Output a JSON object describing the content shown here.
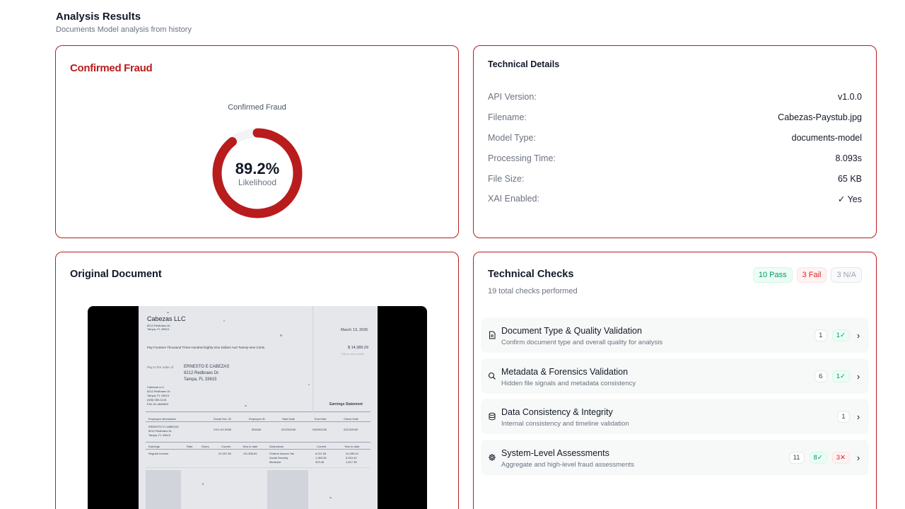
{
  "header": {
    "title": "Analysis Results",
    "subtitle": "Documents Model analysis from history"
  },
  "verdict": {
    "title": "Confirmed Fraud",
    "gauge_label": "Confirmed Fraud",
    "score_text": "89.2%",
    "score_fraction": 0.892,
    "score_sublabel": "Likelihood",
    "color": "#b91c1c"
  },
  "technical_details": {
    "title": "Technical Details",
    "rows": [
      {
        "key": "API Version:",
        "value": "v1.0.0"
      },
      {
        "key": "Filename:",
        "value": "Cabezas-Paystub.jpg"
      },
      {
        "key": "Model Type:",
        "value": "documents-model"
      },
      {
        "key": "Processing Time:",
        "value": "8.093s"
      },
      {
        "key": "File Size:",
        "value": "65 KB"
      },
      {
        "key": "XAI Enabled:",
        "value": "✓ Yes"
      }
    ]
  },
  "document": {
    "title": "Original Document",
    "company": "Cabezas LLC",
    "company_addr1": "8212 Redbraes Dr.",
    "company_addr2": "Tampa, FL 33615",
    "date": "March 13, 2026",
    "amount_words": "Pay Fourteen Thousand Three Hundred Eighty-nine Dollars And Twenty-nine Cents",
    "amount": "$ 14,389.29",
    "not_check": "This is not a check",
    "pay_to_label": "Pay to the order of",
    "payee_name": "ERNESTO E CABEZAS",
    "payee_addr1": "8212 Redbraes Dr.",
    "payee_addr2": "Tampa, FL 33615",
    "employer_block": [
      "Cabezas LLC",
      "8212 Redbraes Dr.",
      "Tampa, FL 33615",
      "(305) 555-0128",
      "EIN: 81-4848524"
    ],
    "earnings_statement": "Earnings Statement",
    "table_headers": [
      "Employee Information",
      "Social Sec. ID",
      "Employee ID",
      "Start Date",
      "End Date",
      "Check Date"
    ],
    "table_values": [
      "ERNESTO E CABEZAS",
      "XXX-XX-5008",
      "554345",
      "02/23/2026",
      "03/09/2026",
      "03/13/2026"
    ],
    "emp_addr1": "8212 Redbraes Dr.",
    "emp_addr2": "Tampa, FL 33615",
    "earn_headers": [
      "Earnings",
      "Rate",
      "Hours",
      "Current",
      "Year to date",
      "Deductions",
      "Current",
      "Year to date"
    ],
    "earn_row": [
      "Regular Income",
      "22,307.69",
      "111,538.69"
    ],
    "deduction_rows": [
      {
        "name": "Federal Income Tax",
        "current": "6,211.06",
        "ytd": "31,059.42"
      },
      {
        "name": "Social Security",
        "current": "1,383.08",
        "ytd": "6,915.40"
      },
      {
        "name": "Medicare",
        "current": "323.46",
        "ytd": "1,617.38"
      }
    ]
  },
  "technical_checks": {
    "title": "Technical Checks",
    "subtitle": "19 total checks performed",
    "badges": {
      "pass": "10 Pass",
      "fail": "3 Fail",
      "na": "3 N/A"
    },
    "items": [
      {
        "icon": "document-icon",
        "name": "Document Type & Quality Validation",
        "desc": "Confirm document type and overall quality for analysis",
        "count": "1",
        "pass": "1✓",
        "fail": ""
      },
      {
        "icon": "search-icon",
        "name": "Metadata & Forensics Validation",
        "desc": "Hidden file signals and metadata consistency",
        "count": "6",
        "pass": "1✓",
        "fail": ""
      },
      {
        "icon": "database-icon",
        "name": "Data Consistency & Integrity",
        "desc": "Internal consistency and timeline validation",
        "count": "1",
        "pass": "",
        "fail": ""
      },
      {
        "icon": "gear-icon",
        "name": "System-Level Assessments",
        "desc": "Aggregate and high-level fraud assessments",
        "count": "11",
        "pass": "8✓",
        "fail": "3✕"
      }
    ]
  }
}
